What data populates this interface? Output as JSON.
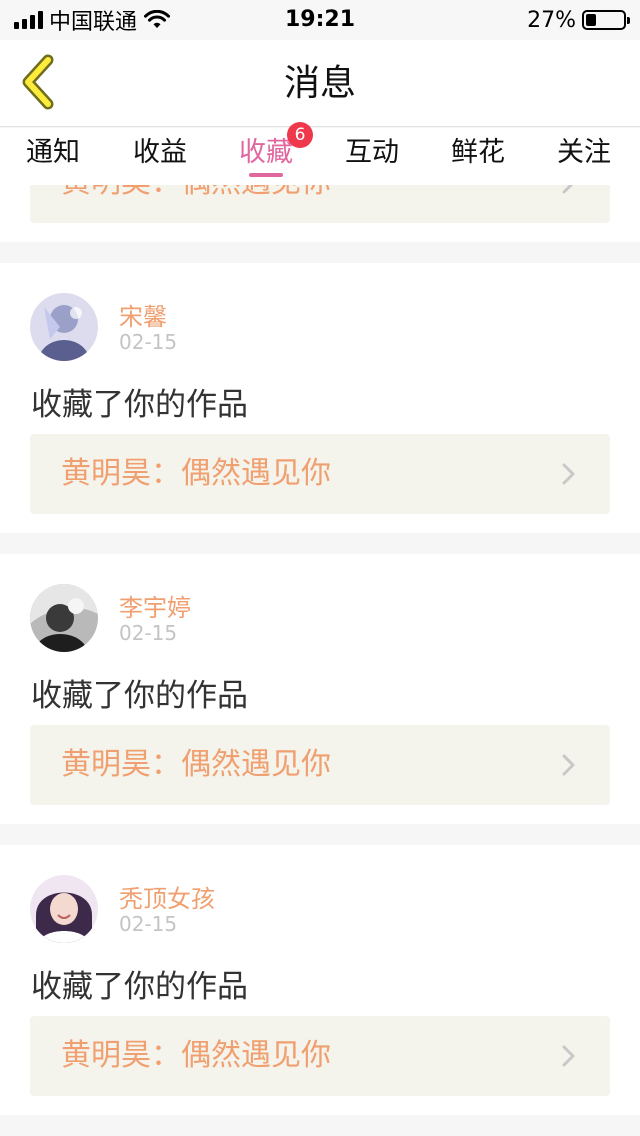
{
  "status_bar": {
    "carrier": "中国联通",
    "time": "19:21",
    "battery_percent": "27%",
    "battery_level": 0.27
  },
  "nav": {
    "title": "消息",
    "back_icon": "chevron-left-icon"
  },
  "tabs": [
    {
      "label": "通知",
      "active": false
    },
    {
      "label": "收益",
      "active": false
    },
    {
      "label": "收藏",
      "active": true,
      "badge": "6"
    },
    {
      "label": "互动",
      "active": false
    },
    {
      "label": "鲜花",
      "active": false
    },
    {
      "label": "关注",
      "active": false
    }
  ],
  "partial_card": {
    "link_text": "黄明昊：偶然遇见你"
  },
  "messages": [
    {
      "name": "宋馨",
      "date": "02-15",
      "action": "收藏了你的作品",
      "link_text": "黄明昊：偶然遇见你"
    },
    {
      "name": "李宇婷",
      "date": "02-15",
      "action": "收藏了你的作品",
      "link_text": "黄明昊：偶然遇见你"
    },
    {
      "name": "秃顶女孩",
      "date": "02-15",
      "action": "收藏了你的作品",
      "link_text": "黄明昊：偶然遇见你"
    }
  ],
  "colors": {
    "accent": "#e0679f",
    "name": "#f0a070",
    "badge": "#f0384d",
    "link_bg": "#f4f4ec"
  }
}
